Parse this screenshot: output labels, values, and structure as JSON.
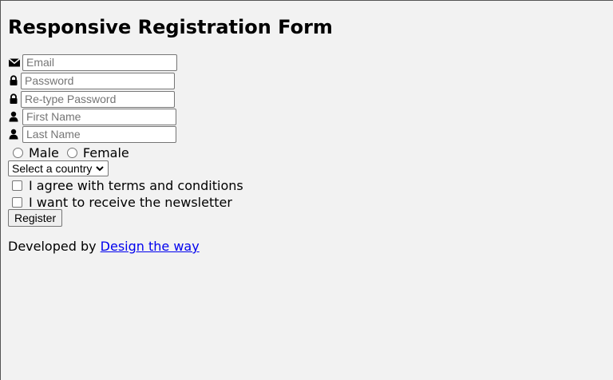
{
  "page": {
    "title": "Responsive Registration Form"
  },
  "form": {
    "email": {
      "placeholder": "Email",
      "value": "",
      "icon": "envelope-icon"
    },
    "password": {
      "placeholder": "Password",
      "value": "",
      "icon": "lock-icon"
    },
    "retype_password": {
      "placeholder": "Re-type Password",
      "value": "",
      "icon": "lock-icon"
    },
    "first_name": {
      "placeholder": "First Name",
      "value": "",
      "icon": "user-icon"
    },
    "last_name": {
      "placeholder": "Last Name",
      "value": "",
      "icon": "user-icon"
    },
    "gender": {
      "options": [
        "Male",
        "Female"
      ],
      "selected": ""
    },
    "country": {
      "selected_label": "Select a country",
      "icon": "chevron-down-icon"
    },
    "terms_label": "I agree with terms and conditions",
    "newsletter_label": "I want to receive the newsletter",
    "register_label": "Register"
  },
  "footer": {
    "prefix": "Developed by",
    "link_text": "Design the way"
  },
  "colors": {
    "background": "#f2f2f2",
    "link": "#0000ee",
    "border": "#767676"
  }
}
